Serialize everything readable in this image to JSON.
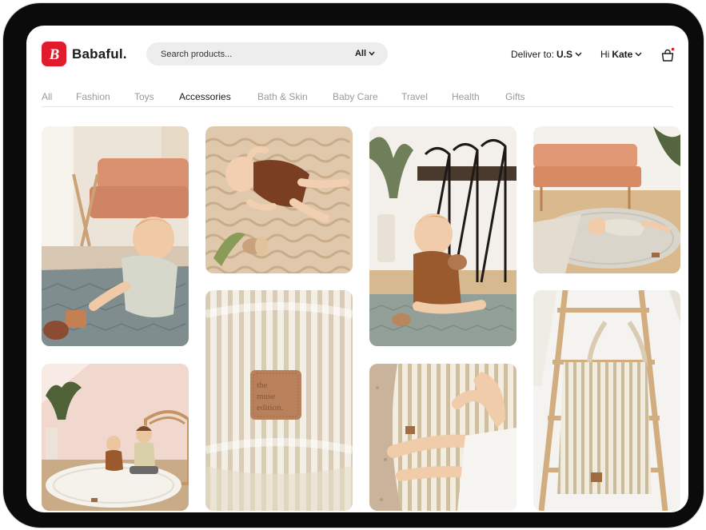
{
  "brand": {
    "name": "Babaful.",
    "logo_letter": "B",
    "accent": "#e21b2c"
  },
  "search": {
    "placeholder": "Search products...",
    "filter": "All"
  },
  "header": {
    "deliver_label": "Deliver to:",
    "deliver_value": "U.S",
    "greeting": "Hi",
    "user": "Kate"
  },
  "nav": {
    "tabs": [
      "All",
      "Fashion",
      "Toys",
      "Accessories",
      "Bath & Skin",
      "Baby Care",
      "Travel",
      "Health",
      "Gifts"
    ],
    "active": "Accessories"
  },
  "gallery": {
    "tiles": [
      "baby-on-quilted-mat-photo",
      "baby-lying-on-wave-mat-photo",
      "baby-sitting-by-dining-chairs-photo",
      "baby-lying-on-round-mat-photo",
      "two-kids-on-round-mat-photo",
      "striped-quilt-label-closeup-photo",
      "baby-feet-on-striped-mat-photo",
      "striped-bag-on-ladder-photo"
    ],
    "label_text": "the muse edition."
  }
}
